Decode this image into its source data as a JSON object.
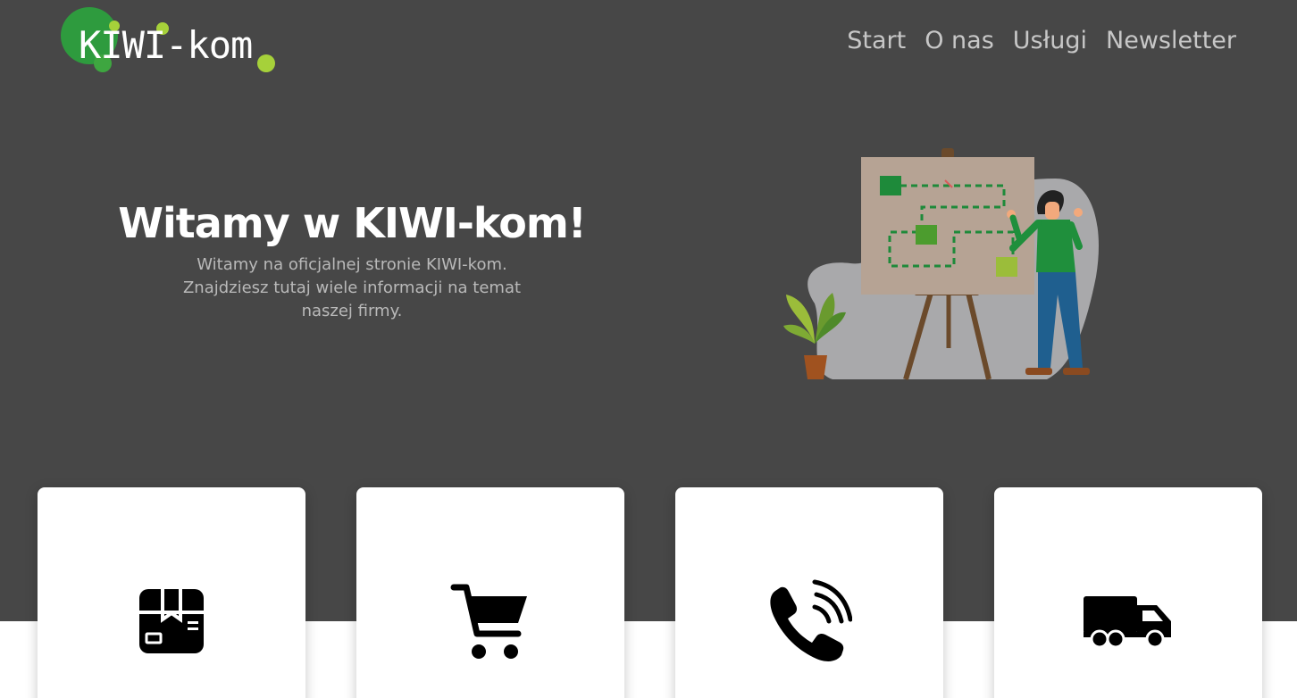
{
  "brand": {
    "name": "KIWI-kom",
    "colors": {
      "dark_green": "#2e9b3e",
      "lime": "#a6d13a"
    }
  },
  "nav": {
    "items": [
      {
        "label": "Start"
      },
      {
        "label": "O nas"
      },
      {
        "label": "Usługi"
      },
      {
        "label": "Newsletter"
      }
    ]
  },
  "hero": {
    "title": "Witamy w KIWI-kom!",
    "subtitle": "Witamy na oficjalnej stronie KIWI-kom. Znajdziesz tutaj wiele informacji na temat naszej firmy.",
    "illustration": "person-planning-roadmap-on-easel"
  },
  "cards": [
    {
      "icon": "package-box-icon"
    },
    {
      "icon": "shopping-cart-icon"
    },
    {
      "icon": "phone-ringing-icon"
    },
    {
      "icon": "delivery-truck-icon"
    }
  ],
  "colors": {
    "hero_background": "#474747",
    "nav_text": "#c7c7c7",
    "subtitle_text": "#b9b9b9",
    "card_background": "#ffffff"
  }
}
